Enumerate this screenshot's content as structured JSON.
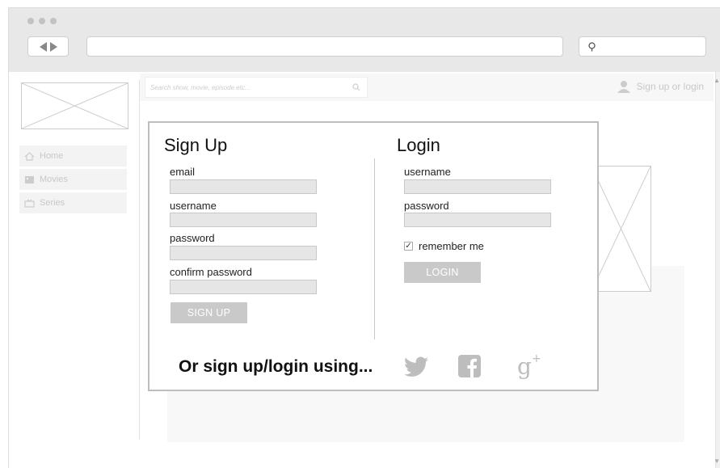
{
  "header": {
    "search_placeholder": "Search show, movie, episode etc...",
    "user_link": "Sign up or login"
  },
  "sidebar": {
    "items": [
      {
        "label": "Home",
        "icon": "home-icon"
      },
      {
        "label": "Movies",
        "icon": "movies-icon"
      },
      {
        "label": "Series",
        "icon": "series-icon"
      }
    ]
  },
  "signup": {
    "title": "Sign Up",
    "fields": [
      {
        "label": "email",
        "value": ""
      },
      {
        "label": "username",
        "value": ""
      },
      {
        "label": "password",
        "value": ""
      },
      {
        "label": "confirm password",
        "value": ""
      }
    ],
    "button": "SIGN UP"
  },
  "login": {
    "title": "Login",
    "fields": [
      {
        "label": "username",
        "value": ""
      },
      {
        "label": "password",
        "value": ""
      }
    ],
    "remember_label": "remember me",
    "remember_checked": true,
    "button": "LOGIN"
  },
  "social": {
    "prompt": "Or sign up/login using...",
    "providers": [
      "twitter-icon",
      "facebook-icon",
      "google-plus-icon"
    ]
  },
  "colors": {
    "chrome": "#e8e8e8",
    "button": "#c9c9c9",
    "input": "#e6e6e6",
    "social_icons": "#bdbdbd"
  }
}
